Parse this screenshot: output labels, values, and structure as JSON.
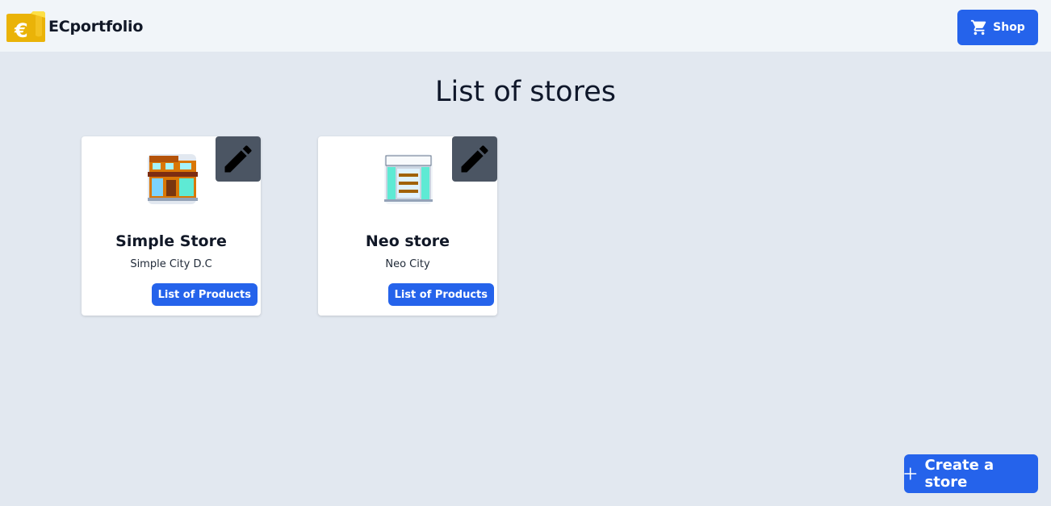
{
  "header": {
    "brand": "ECportfolio",
    "logo_icon": "euro-wallet-icon",
    "shop_label": "Shop",
    "shop_icon": "cart-icon"
  },
  "main": {
    "title": "List of stores",
    "stores": [
      {
        "name": "Simple Store",
        "city": "Simple City D.C",
        "products_label": "List of Products",
        "edit_icon": "pencil-icon"
      },
      {
        "name": "Neo store",
        "city": "Neo City",
        "products_label": "List of Products",
        "edit_icon": "pencil-icon"
      }
    ],
    "create_label": "Create a store",
    "create_icon": "plus-icon"
  },
  "colors": {
    "accent": "#2563eb",
    "background": "#e2e8f0",
    "header": "#f1f5f9",
    "logo": "#eab308",
    "edit_button": "#4b5563"
  }
}
